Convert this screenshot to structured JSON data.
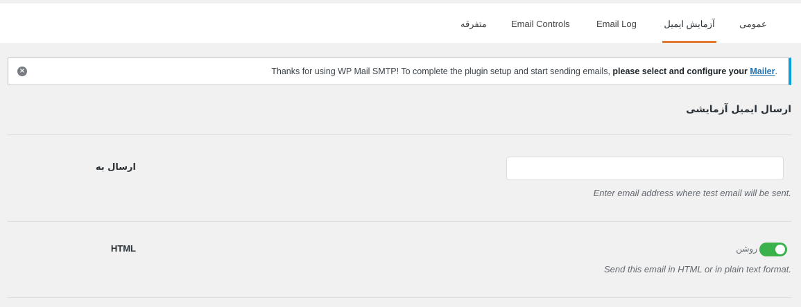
{
  "tabs": [
    {
      "label": "عمومی",
      "active": false
    },
    {
      "label": "آزمایش ایمیل",
      "active": true
    },
    {
      "label": "Email Log",
      "active": false
    },
    {
      "label": "Email Controls",
      "active": false
    },
    {
      "label": "متفرقه",
      "active": false
    }
  ],
  "notice": {
    "text_start": "Thanks for using WP Mail SMTP! To complete the plugin setup and start sending emails, ",
    "text_bold": "please select and configure your ",
    "link": "Mailer",
    "text_end": "."
  },
  "section": {
    "title": "ارسال ایمیل آزمایشی"
  },
  "send_to": {
    "label": "ارسال به",
    "value": "",
    "help": "Enter email address where test email will be sent."
  },
  "html_row": {
    "label": "HTML",
    "toggle_label": "روشن",
    "toggle_on": true,
    "help": "Send this email in HTML or in plain text format."
  },
  "colors": {
    "accent_tab": "#e27730",
    "notice_border": "#0aa0d9",
    "toggle_on": "#3ab14b",
    "link": "#2271b1"
  }
}
